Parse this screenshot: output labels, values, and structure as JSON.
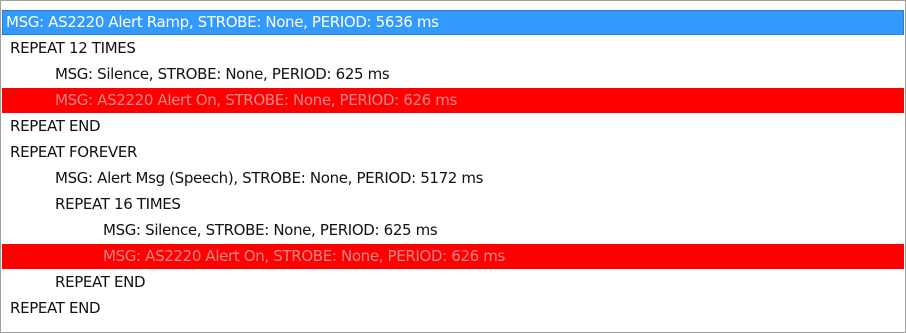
{
  "colors": {
    "selection": "#3399ff",
    "alert_highlight": "#ff0000",
    "alert_text": "#e08a8a",
    "text": "#111111"
  },
  "sequence": [
    {
      "text": "MSG: AS2220 Alert Ramp, STROBE: None, PERIOD: 5636 ms",
      "state": "selected"
    },
    {
      "text": "REPEAT 12 TIMES",
      "state": "normal"
    },
    {
      "text": "MSG: Silence, STROBE: None, PERIOD: 625 ms",
      "state": "normal"
    },
    {
      "text": "MSG: AS2220 Alert On, STROBE: None, PERIOD: 626 ms",
      "state": "alert"
    },
    {
      "text": "REPEAT END",
      "state": "normal"
    },
    {
      "text": "REPEAT FOREVER",
      "state": "normal"
    },
    {
      "text": "MSG: Alert Msg (Speech), STROBE: None, PERIOD: 5172 ms",
      "state": "normal"
    },
    {
      "text": "REPEAT 16 TIMES",
      "state": "normal"
    },
    {
      "text": "MSG: Silence, STROBE: None, PERIOD: 625 ms",
      "state": "normal"
    },
    {
      "text": "MSG: AS2220 Alert On, STROBE: None, PERIOD: 626 ms",
      "state": "alert"
    },
    {
      "text": "REPEAT END",
      "state": "normal"
    },
    {
      "text": "REPEAT END",
      "state": "normal"
    }
  ]
}
